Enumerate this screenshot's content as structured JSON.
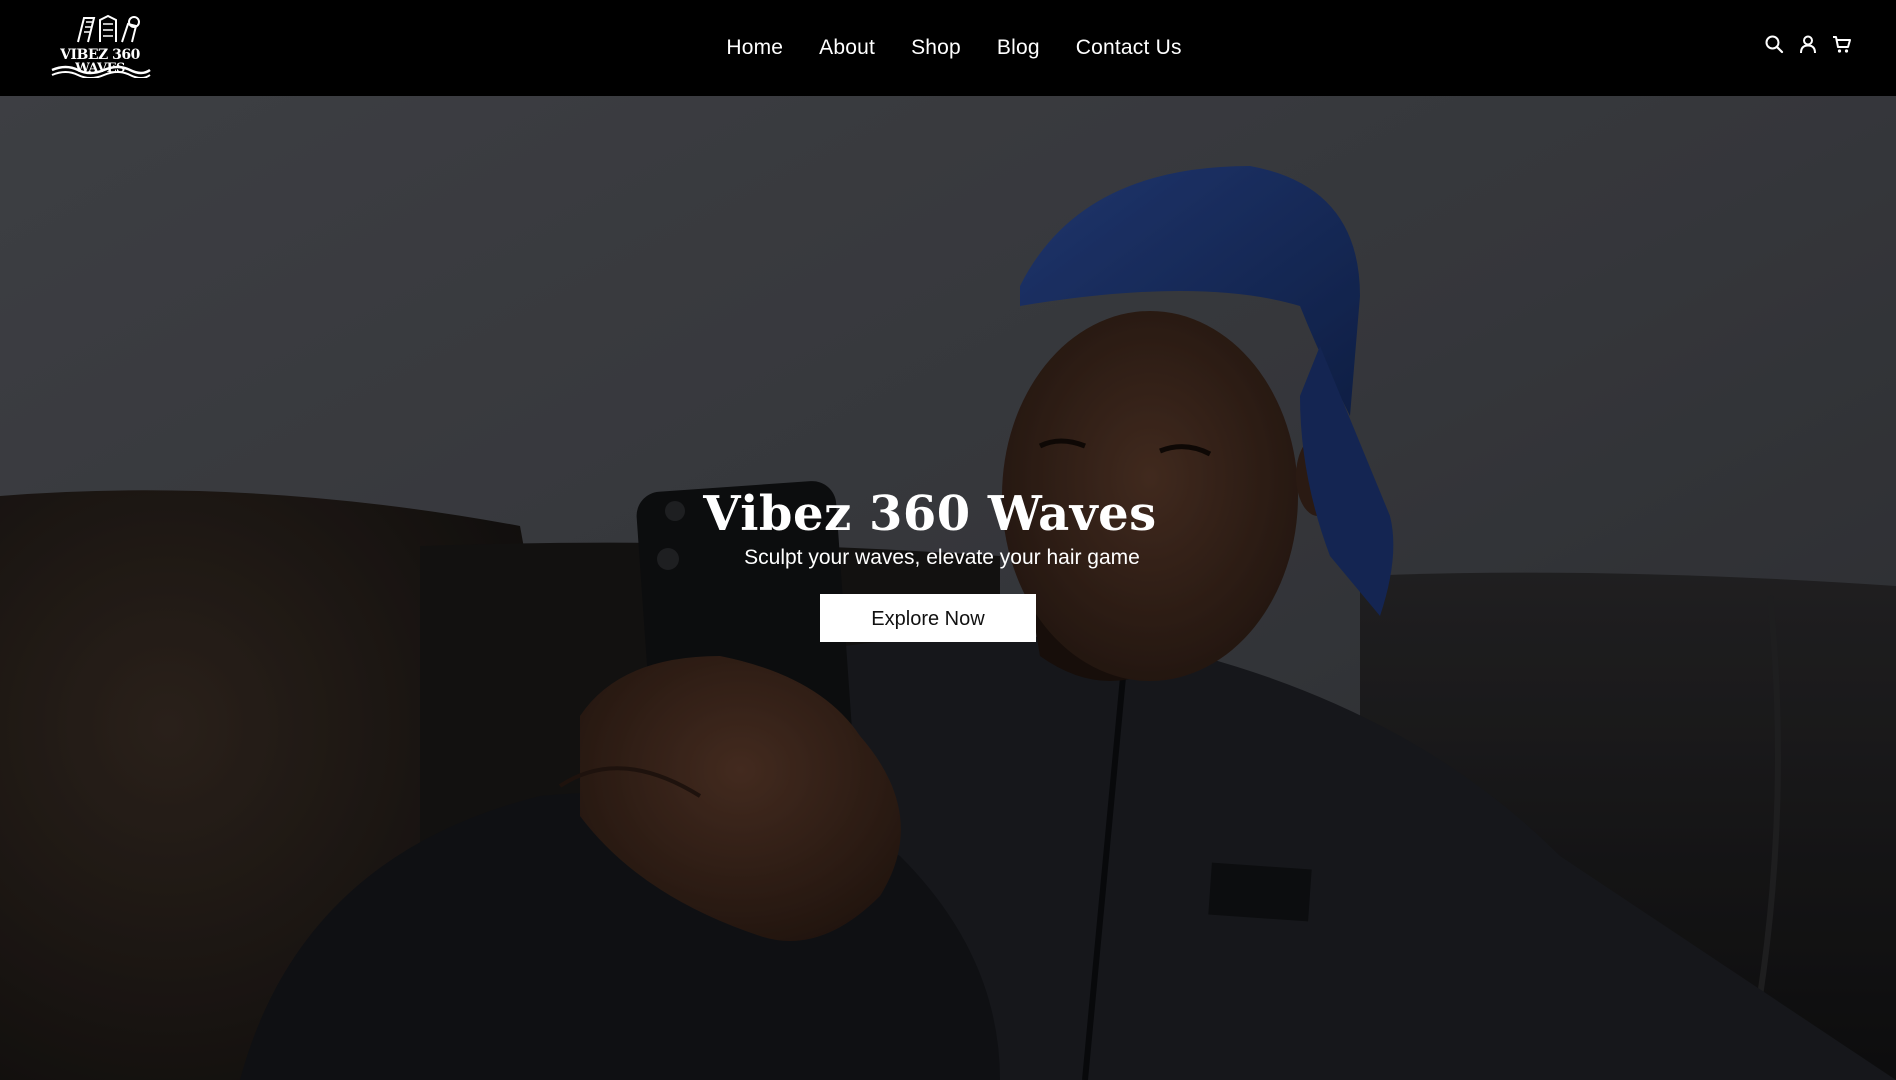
{
  "header": {
    "logo": {
      "text_line1": "VIBEZ 360",
      "text_line2": "WAVES"
    },
    "nav": [
      {
        "label": "Home"
      },
      {
        "label": "About"
      },
      {
        "label": "Shop"
      },
      {
        "label": "Blog"
      },
      {
        "label": "Contact Us"
      }
    ],
    "icons": [
      "search-icon",
      "account-icon",
      "cart-icon"
    ]
  },
  "hero": {
    "title": "Vibez 360 Waves",
    "subtitle": "Sculpt your waves, elevate your hair game",
    "button_label": "Explore Now"
  },
  "colors": {
    "header_bg": "#000000",
    "text": "#ffffff",
    "button_bg": "#ffffff",
    "button_text": "#111111",
    "durag": "#1f3a7a"
  }
}
